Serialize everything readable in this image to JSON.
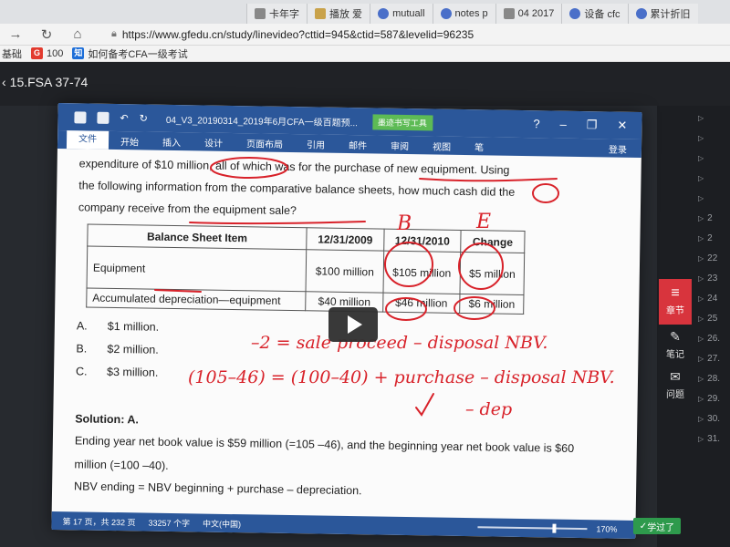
{
  "browser": {
    "tabs": [
      {
        "label": "卡年字",
        "icon": "doc-icon"
      },
      {
        "label": "播放 爱",
        "icon": "folder-icon"
      },
      {
        "label": "mutuall",
        "icon": "paw-icon"
      },
      {
        "label": "notes p",
        "icon": "paw-icon"
      },
      {
        "label": "04 2017",
        "icon": "doc-icon"
      },
      {
        "label": "设备 cfc",
        "icon": "paw-icon"
      },
      {
        "label": "累计折旧",
        "icon": "paw-icon"
      }
    ],
    "url": "https://www.gfedu.cn/study/linevideo?cttid=945&ctid=587&levelid=96235",
    "bookmarks": [
      {
        "label": "基础",
        "icon": "text"
      },
      {
        "label": "100",
        "icon": "red-g-icon"
      },
      {
        "label": "如何备考CFA一级考试",
        "icon": "zhihu-icon"
      }
    ]
  },
  "course": {
    "back_title": "15.FSA 37-74"
  },
  "word": {
    "doc_title": "04_V3_20190314_2019年6月CFA一级百题预...",
    "draw_tools": "墨迹书写工具",
    "menu": [
      "文件",
      "开始",
      "插入",
      "设计",
      "页面布局",
      "引用",
      "邮件",
      "审阅",
      "视图",
      "笔"
    ],
    "login": "登录",
    "status": {
      "page": "第 17 页，共 232 页",
      "words": "33257 个字",
      "lang": "中文(中国)",
      "zoom": "170%"
    }
  },
  "doc": {
    "line1": "expenditure of $10 million, all of which was for the purchase of new equipment. Using",
    "line2": "the following information from the comparative balance sheets, how much cash did the",
    "line3": "company receive from the equipment sale?",
    "table": {
      "headers": [
        "Balance Sheet Item",
        "12/31/2009",
        "12/31/2010",
        "Change"
      ],
      "rows": [
        [
          "Equipment",
          "$100 million",
          "$105 million",
          "$5 million"
        ],
        [
          "Accumulated depreciation—equipment",
          "$40 million",
          "$46 million",
          "$6 million"
        ]
      ]
    },
    "options": [
      {
        "letter": "A.",
        "text": "$1 million."
      },
      {
        "letter": "B.",
        "text": "$2 million."
      },
      {
        "letter": "C.",
        "text": "$3 million."
      }
    ],
    "solution_title": "Solution: A.",
    "solution_line1": "Ending year net book value is $59 million (=105 –46), and the beginning year net book value is $60",
    "solution_line2": "million (=100 –40).",
    "nbv_formula": "NBV ending = NBV beginning + purchase – depreciation."
  },
  "handwriting": {
    "b_mark": "B",
    "e_mark": "E",
    "line1": "–2 = sale proceed – disposal NBV.",
    "line2": "(105–46) = (100–40) + purchase – disposal NBV.",
    "line3": "– dep"
  },
  "tools": {
    "chapter": "章节",
    "notes": "笔记",
    "questions": "问题",
    "learned": "学过了"
  },
  "chapters": [
    "",
    "",
    "",
    "",
    "",
    "2",
    "2",
    "22",
    "23",
    "24",
    "25",
    "26.",
    "27.",
    "28.",
    "29.",
    "30.",
    "31."
  ]
}
